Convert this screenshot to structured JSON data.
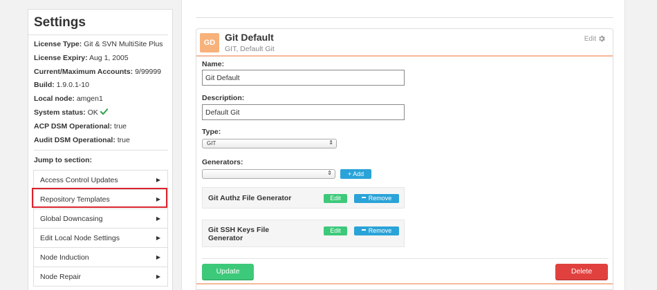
{
  "sidebar": {
    "title": "Settings",
    "info": [
      {
        "label": "License Type:",
        "value": "Git & SVN MultiSite Plus"
      },
      {
        "label": "License Expiry:",
        "value": "Aug 1, 2005"
      },
      {
        "label": "Current/Maximum Accounts:",
        "value": "9/99999"
      },
      {
        "label": "Build:",
        "value": "1.9.0.1-10"
      },
      {
        "label": "Local node:",
        "value": "amgen1"
      },
      {
        "label": "System status:",
        "value": "OK"
      },
      {
        "label": "ACP DSM Operational:",
        "value": "true"
      },
      {
        "label": "Audit DSM Operational:",
        "value": "true"
      }
    ],
    "jump_label": "Jump to section:",
    "menu": [
      "Access Control Updates",
      "Repository Templates",
      "Global Downcasing",
      "Edit Local Node Settings",
      "Node Induction",
      "Node Repair"
    ],
    "highlighted_item": "Repository Templates"
  },
  "card": {
    "avatar": "GD",
    "avatar_color": "#f7b27b",
    "title": "Git Default",
    "subtitle": "GIT, Default Git",
    "edit_label": "Edit",
    "edit_icon": "gear-icon",
    "fields": {
      "name_label": "Name:",
      "name_value": "Git Default",
      "description_label": "Description:",
      "description_value": "Default Git",
      "type_label": "Type:",
      "type_value": "GIT",
      "generators_label": "Generators:",
      "generators_value": "",
      "add_label": "+ Add"
    },
    "generators": [
      {
        "name": "Git Authz File Generator",
        "edit": "Edit",
        "remove": "Remove"
      },
      {
        "name": "Git SSH Keys File Generator",
        "edit": "Edit",
        "remove": "Remove"
      }
    ],
    "update_label": "Update",
    "delete_label": "Delete"
  },
  "colors": {
    "accent_green": "#3dc97a",
    "accent_blue": "#2aa3d8",
    "danger_red": "#e0413f",
    "highlight_red": "#d9232d"
  }
}
